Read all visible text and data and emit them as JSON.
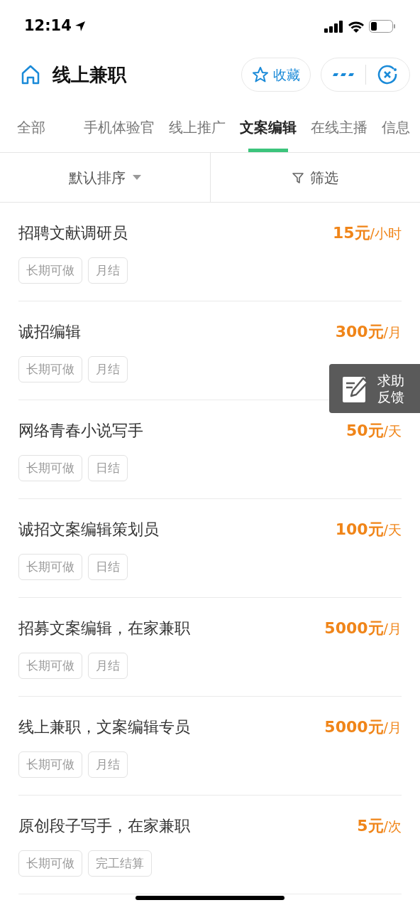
{
  "status_bar": {
    "time": "12:14"
  },
  "header": {
    "title": "线上兼职",
    "favorite_label": "收藏"
  },
  "tabs": [
    {
      "label": "全部",
      "selected": false
    },
    {
      "label": "手机体验官",
      "selected": false
    },
    {
      "label": "线上推广",
      "selected": false
    },
    {
      "label": "文案编辑",
      "selected": true
    },
    {
      "label": "在线主播",
      "selected": false
    },
    {
      "label": "信息",
      "selected": false
    }
  ],
  "sort_bar": {
    "sort_label": "默认排序",
    "filter_label": "筛选"
  },
  "jobs": [
    {
      "title": "招聘文献调研员",
      "amount": "15元",
      "unit": "/小时",
      "tags": [
        "长期可做",
        "月结"
      ]
    },
    {
      "title": "诚招编辑",
      "amount": "300元",
      "unit": "/月",
      "tags": [
        "长期可做",
        "月结"
      ]
    },
    {
      "title": "网络青春小说写手",
      "amount": "50元",
      "unit": "/天",
      "tags": [
        "长期可做",
        "日结"
      ]
    },
    {
      "title": "诚招文案编辑策划员",
      "amount": "100元",
      "unit": "/天",
      "tags": [
        "长期可做",
        "日结"
      ]
    },
    {
      "title": "招募文案编辑，在家兼职",
      "amount": "5000元",
      "unit": "/月",
      "tags": [
        "长期可做",
        "月结"
      ]
    },
    {
      "title": "线上兼职，文案编辑专员",
      "amount": "5000元",
      "unit": "/月",
      "tags": [
        "长期可做",
        "月结"
      ]
    },
    {
      "title": "原创段子写手，在家兼职",
      "amount": "5元",
      "unit": "/次",
      "tags": [
        "长期可做",
        "完工结算"
      ]
    }
  ],
  "feedback_button": {
    "label_line_1": "求助",
    "label_line_2": "反馈"
  }
}
